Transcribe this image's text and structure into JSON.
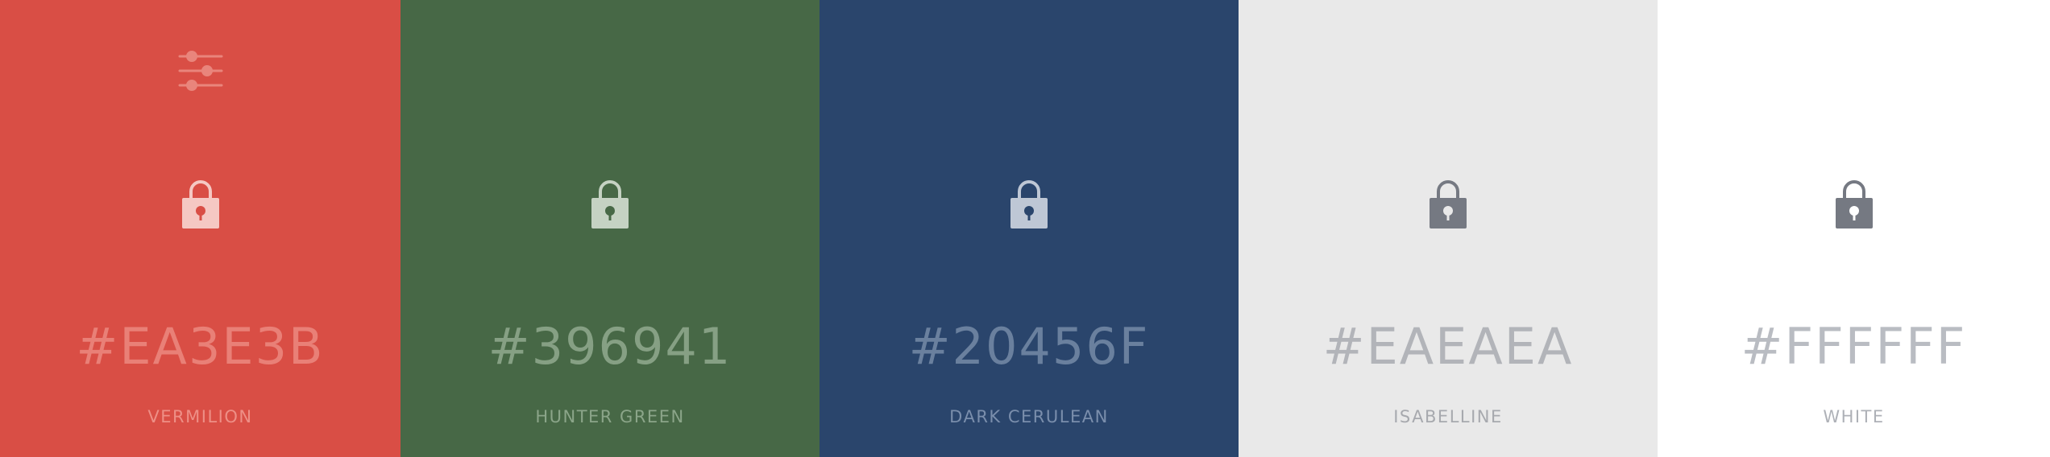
{
  "palette": {
    "swatches": [
      {
        "hex": "#EA3E3B",
        "name": "VERMILION",
        "background": "#D94E45",
        "hex_color": "#E98077",
        "name_color": "#EE8F86",
        "lock_color": "#F5C8C3",
        "lock_keyhole_color": "#D94E45",
        "adjust_icon_color": "#E9857C",
        "icons": [
          "adjust-icon",
          "lock-icon"
        ]
      },
      {
        "hex": "#396941",
        "name": "HUNTER GREEN",
        "background": "#476846",
        "hex_color": "#86A084",
        "name_color": "#8BA589",
        "lock_color": "#C5D2C3",
        "lock_keyhole_color": "#476846",
        "icons": [
          "lock-icon"
        ]
      },
      {
        "hex": "#20456F",
        "name": "DARK CERULEAN",
        "background": "#2A456C",
        "hex_color": "#6A809E",
        "name_color": "#7A8EAC",
        "lock_color": "#BEC7D5",
        "lock_keyhole_color": "#2A456C",
        "icons": [
          "lock-icon"
        ]
      },
      {
        "hex": "#EAEAEA",
        "name": "ISABELLINE",
        "background": "#E9E9E9",
        "hex_color": "#B2B4B9",
        "name_color": "#A7A9AE",
        "lock_color": "#757982",
        "lock_keyhole_color": "#E9E9E9",
        "icons": [
          "lock-icon"
        ]
      },
      {
        "hex": "#FFFFFF",
        "name": "WHITE",
        "background": "#FFFFFF",
        "hex_color": "#B9BCC2",
        "name_color": "#AEB1B7",
        "lock_color": "#757982",
        "lock_keyhole_color": "#FFFFFF",
        "icons": [
          "lock-icon"
        ]
      }
    ]
  }
}
